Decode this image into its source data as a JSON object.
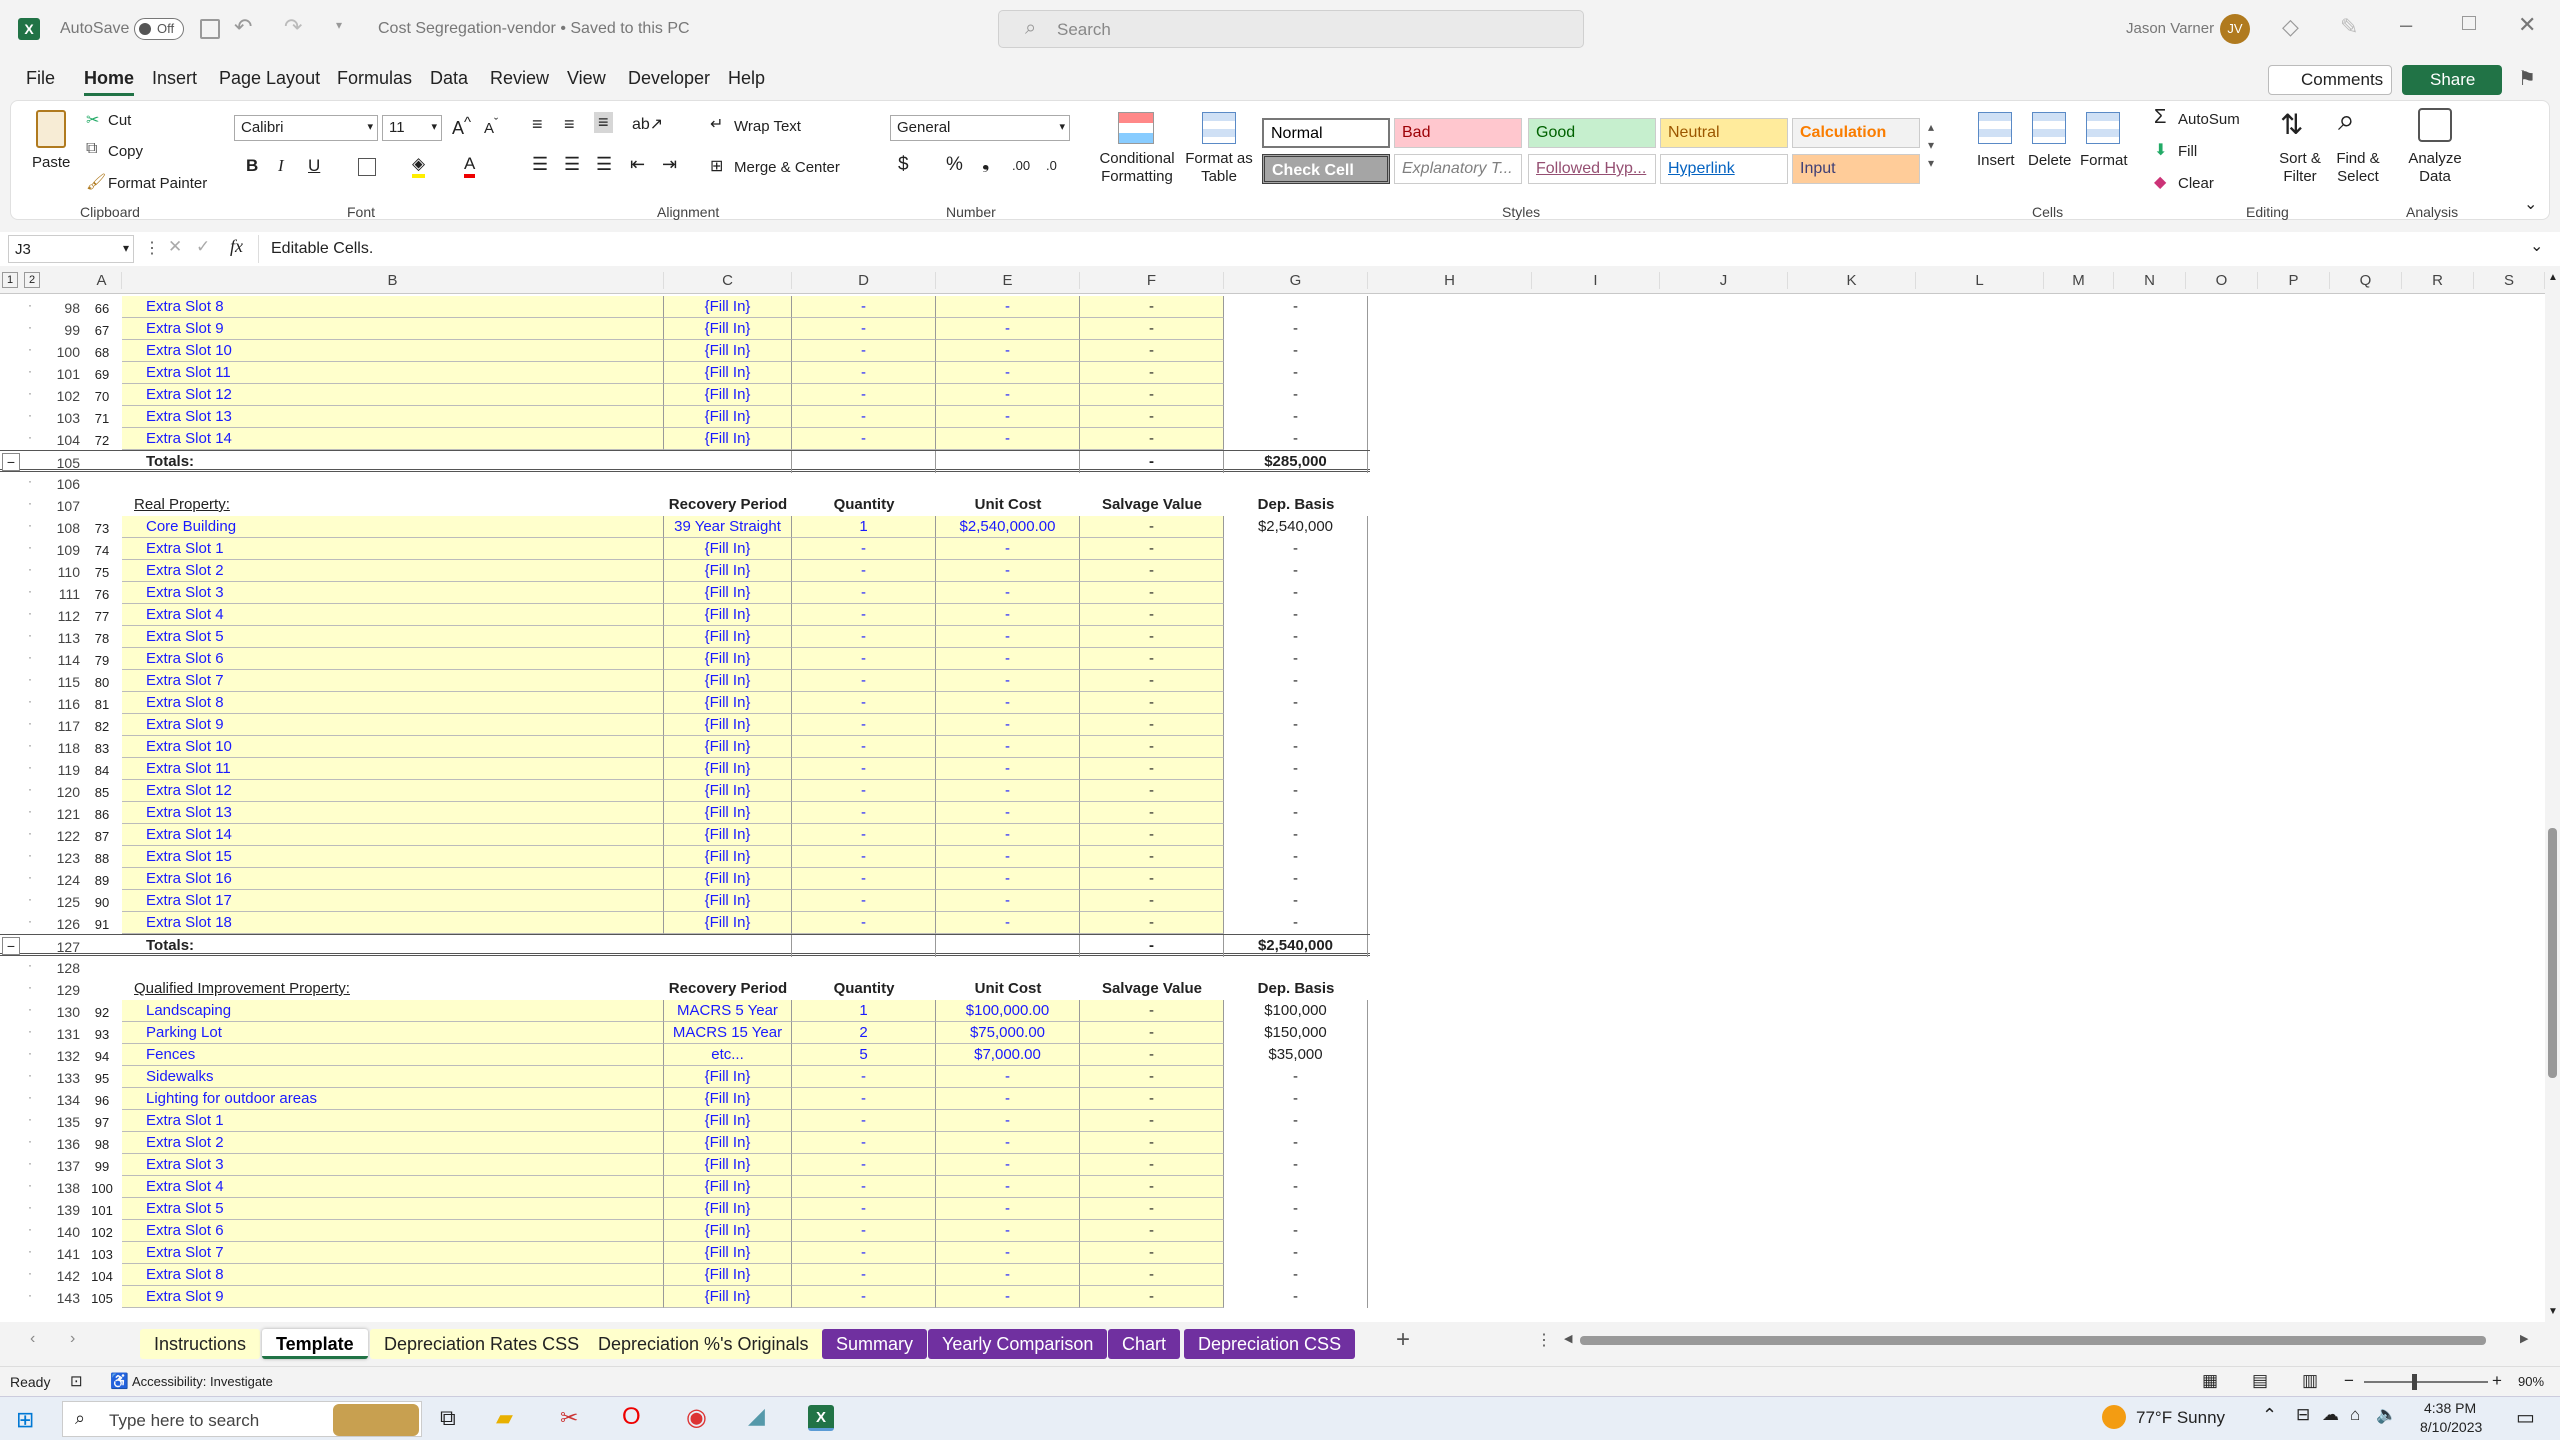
{
  "titlebar": {
    "autosave": "AutoSave",
    "autosave_state": "Off",
    "doc_title": "Cost Segregation-vendor • Saved to this PC",
    "search_placeholder": "Search",
    "user_name": "Jason Varner",
    "user_initials": "JV"
  },
  "menu": [
    "File",
    "Home",
    "Insert",
    "Page Layout",
    "Formulas",
    "Data",
    "Review",
    "View",
    "Developer",
    "Help"
  ],
  "menu_right": {
    "comments": "Comments",
    "share": "Share"
  },
  "ribbon": {
    "clipboard": {
      "paste": "Paste",
      "cut": "Cut",
      "copy": "Copy",
      "format_painter": "Format Painter",
      "label": "Clipboard"
    },
    "font": {
      "name": "Calibri",
      "size": "11",
      "label": "Font"
    },
    "alignment": {
      "wrap": "Wrap Text",
      "merge": "Merge & Center",
      "label": "Alignment"
    },
    "number": {
      "format": "General",
      "label": "Number"
    },
    "styles": {
      "cond": "Conditional Formatting",
      "table": "Format as Table",
      "label": "Styles",
      "cells": [
        {
          "t": "Normal",
          "bg": "#ffffff",
          "fg": "#000000"
        },
        {
          "t": "Bad",
          "bg": "#ffc7ce",
          "fg": "#9c0006"
        },
        {
          "t": "Good",
          "bg": "#c6efce",
          "fg": "#006100"
        },
        {
          "t": "Neutral",
          "bg": "#ffeb9c",
          "fg": "#9c5700"
        },
        {
          "t": "Calculation",
          "bg": "#f2f2f2",
          "fg": "#fa7d00"
        },
        {
          "t": "Check Cell",
          "bg": "#a5a5a5",
          "fg": "#ffffff"
        },
        {
          "t": "Explanatory T...",
          "bg": "#ffffff",
          "fg": "#7f7f7f"
        },
        {
          "t": "Followed Hyp...",
          "bg": "#ffffff",
          "fg": "#954f72"
        },
        {
          "t": "Hyperlink",
          "bg": "#ffffff",
          "fg": "#0563c1"
        },
        {
          "t": "Input",
          "bg": "#ffcc99",
          "fg": "#3f3f76"
        }
      ]
    },
    "cells": {
      "insert": "Insert",
      "delete": "Delete",
      "format": "Format",
      "label": "Cells"
    },
    "editing": {
      "autosum": "AutoSum",
      "fill": "Fill",
      "clear": "Clear",
      "sort": "Sort & Filter",
      "find": "Find & Select",
      "label": "Editing"
    },
    "analysis": {
      "analyze": "Analyze Data",
      "label": "Analysis"
    }
  },
  "formula_bar": {
    "name_box": "J3",
    "formula": "Editable Cells."
  },
  "columns": [
    "A",
    "B",
    "C",
    "D",
    "E",
    "F",
    "G",
    "H",
    "I",
    "J",
    "K",
    "L",
    "M",
    "N",
    "O",
    "P",
    "Q",
    "R",
    "S"
  ],
  "sheet": {
    "headers": {
      "recovery": "Recovery Period",
      "quantity": "Quantity",
      "unit_cost": "Unit Cost",
      "salvage": "Salvage Value",
      "basis": "Dep. Basis"
    },
    "real_property_title": "Real Property:",
    "qip_title": "Qualified Improvement Property:",
    "totals_label": "Totals:",
    "rows": [
      {
        "rn": "98",
        "a": "66",
        "b": "Extra Slot 8",
        "c": "{Fill In}",
        "d": "-",
        "e": "-",
        "f": "-",
        "g": "-",
        "k": "d"
      },
      {
        "rn": "99",
        "a": "67",
        "b": "Extra Slot 9",
        "c": "{Fill In}",
        "d": "-",
        "e": "-",
        "f": "-",
        "g": "-",
        "k": "d"
      },
      {
        "rn": "100",
        "a": "68",
        "b": "Extra Slot 10",
        "c": "{Fill In}",
        "d": "-",
        "e": "-",
        "f": "-",
        "g": "-",
        "k": "d"
      },
      {
        "rn": "101",
        "a": "69",
        "b": "Extra Slot 11",
        "c": "{Fill In}",
        "d": "-",
        "e": "-",
        "f": "-",
        "g": "-",
        "k": "d"
      },
      {
        "rn": "102",
        "a": "70",
        "b": "Extra Slot 12",
        "c": "{Fill In}",
        "d": "-",
        "e": "-",
        "f": "-",
        "g": "-",
        "k": "d"
      },
      {
        "rn": "103",
        "a": "71",
        "b": "Extra Slot 13",
        "c": "{Fill In}",
        "d": "-",
        "e": "-",
        "f": "-",
        "g": "-",
        "k": "d"
      },
      {
        "rn": "104",
        "a": "72",
        "b": "Extra Slot 14",
        "c": "{Fill In}",
        "d": "-",
        "e": "-",
        "f": "-",
        "g": "-",
        "k": "d"
      },
      {
        "rn": "105",
        "b": "Totals:",
        "f": "-",
        "g": "$285,000",
        "k": "t"
      },
      {
        "rn": "106",
        "k": "e"
      },
      {
        "rn": "107",
        "b": "Real Property:",
        "k": "h"
      },
      {
        "rn": "108",
        "a": "73",
        "b": "Core Building",
        "c": "39 Year Straight",
        "d": "1",
        "e": "$2,540,000.00",
        "f": "-",
        "g": "$2,540,000",
        "k": "d"
      },
      {
        "rn": "109",
        "a": "74",
        "b": "Extra Slot 1",
        "c": "{Fill In}",
        "d": "-",
        "e": "-",
        "f": "-",
        "g": "-",
        "k": "d"
      },
      {
        "rn": "110",
        "a": "75",
        "b": "Extra Slot 2",
        "c": "{Fill In}",
        "d": "-",
        "e": "-",
        "f": "-",
        "g": "-",
        "k": "d"
      },
      {
        "rn": "111",
        "a": "76",
        "b": "Extra Slot 3",
        "c": "{Fill In}",
        "d": "-",
        "e": "-",
        "f": "-",
        "g": "-",
        "k": "d"
      },
      {
        "rn": "112",
        "a": "77",
        "b": "Extra Slot 4",
        "c": "{Fill In}",
        "d": "-",
        "e": "-",
        "f": "-",
        "g": "-",
        "k": "d"
      },
      {
        "rn": "113",
        "a": "78",
        "b": "Extra Slot 5",
        "c": "{Fill In}",
        "d": "-",
        "e": "-",
        "f": "-",
        "g": "-",
        "k": "d"
      },
      {
        "rn": "114",
        "a": "79",
        "b": "Extra Slot 6",
        "c": "{Fill In}",
        "d": "-",
        "e": "-",
        "f": "-",
        "g": "-",
        "k": "d"
      },
      {
        "rn": "115",
        "a": "80",
        "b": "Extra Slot 7",
        "c": "{Fill In}",
        "d": "-",
        "e": "-",
        "f": "-",
        "g": "-",
        "k": "d"
      },
      {
        "rn": "116",
        "a": "81",
        "b": "Extra Slot 8",
        "c": "{Fill In}",
        "d": "-",
        "e": "-",
        "f": "-",
        "g": "-",
        "k": "d"
      },
      {
        "rn": "117",
        "a": "82",
        "b": "Extra Slot 9",
        "c": "{Fill In}",
        "d": "-",
        "e": "-",
        "f": "-",
        "g": "-",
        "k": "d"
      },
      {
        "rn": "118",
        "a": "83",
        "b": "Extra Slot 10",
        "c": "{Fill In}",
        "d": "-",
        "e": "-",
        "f": "-",
        "g": "-",
        "k": "d"
      },
      {
        "rn": "119",
        "a": "84",
        "b": "Extra Slot 11",
        "c": "{Fill In}",
        "d": "-",
        "e": "-",
        "f": "-",
        "g": "-",
        "k": "d"
      },
      {
        "rn": "120",
        "a": "85",
        "b": "Extra Slot 12",
        "c": "{Fill In}",
        "d": "-",
        "e": "-",
        "f": "-",
        "g": "-",
        "k": "d"
      },
      {
        "rn": "121",
        "a": "86",
        "b": "Extra Slot 13",
        "c": "{Fill In}",
        "d": "-",
        "e": "-",
        "f": "-",
        "g": "-",
        "k": "d"
      },
      {
        "rn": "122",
        "a": "87",
        "b": "Extra Slot 14",
        "c": "{Fill In}",
        "d": "-",
        "e": "-",
        "f": "-",
        "g": "-",
        "k": "d"
      },
      {
        "rn": "123",
        "a": "88",
        "b": "Extra Slot 15",
        "c": "{Fill In}",
        "d": "-",
        "e": "-",
        "f": "-",
        "g": "-",
        "k": "d"
      },
      {
        "rn": "124",
        "a": "89",
        "b": "Extra Slot 16",
        "c": "{Fill In}",
        "d": "-",
        "e": "-",
        "f": "-",
        "g": "-",
        "k": "d"
      },
      {
        "rn": "125",
        "a": "90",
        "b": "Extra Slot 17",
        "c": "{Fill In}",
        "d": "-",
        "e": "-",
        "f": "-",
        "g": "-",
        "k": "d"
      },
      {
        "rn": "126",
        "a": "91",
        "b": "Extra Slot 18",
        "c": "{Fill In}",
        "d": "-",
        "e": "-",
        "f": "-",
        "g": "-",
        "k": "d"
      },
      {
        "rn": "127",
        "b": "Totals:",
        "f": "-",
        "g": "$2,540,000",
        "k": "t"
      },
      {
        "rn": "128",
        "k": "e"
      },
      {
        "rn": "129",
        "b": "Qualified Improvement Property:",
        "k": "h"
      },
      {
        "rn": "130",
        "a": "92",
        "b": "Landscaping",
        "c": "MACRS 5 Year",
        "d": "1",
        "e": "$100,000.00",
        "f": "-",
        "g": "$100,000",
        "k": "d"
      },
      {
        "rn": "131",
        "a": "93",
        "b": "Parking Lot",
        "c": "MACRS 15 Year",
        "d": "2",
        "e": "$75,000.00",
        "f": "-",
        "g": "$150,000",
        "k": "d"
      },
      {
        "rn": "132",
        "a": "94",
        "b": "Fences",
        "c": "etc...",
        "d": "5",
        "e": "$7,000.00",
        "f": "-",
        "g": "$35,000",
        "k": "d"
      },
      {
        "rn": "133",
        "a": "95",
        "b": "Sidewalks",
        "c": "{Fill In}",
        "d": "-",
        "e": "-",
        "f": "-",
        "g": "-",
        "k": "d"
      },
      {
        "rn": "134",
        "a": "96",
        "b": "Lighting for outdoor areas",
        "c": "{Fill In}",
        "d": "-",
        "e": "-",
        "f": "-",
        "g": "-",
        "k": "d"
      },
      {
        "rn": "135",
        "a": "97",
        "b": "Extra Slot 1",
        "c": "{Fill In}",
        "d": "-",
        "e": "-",
        "f": "-",
        "g": "-",
        "k": "d"
      },
      {
        "rn": "136",
        "a": "98",
        "b": "Extra Slot 2",
        "c": "{Fill In}",
        "d": "-",
        "e": "-",
        "f": "-",
        "g": "-",
        "k": "d"
      },
      {
        "rn": "137",
        "a": "99",
        "b": "Extra Slot 3",
        "c": "{Fill In}",
        "d": "-",
        "e": "-",
        "f": "-",
        "g": "-",
        "k": "d"
      },
      {
        "rn": "138",
        "a": "100",
        "b": "Extra Slot 4",
        "c": "{Fill In}",
        "d": "-",
        "e": "-",
        "f": "-",
        "g": "-",
        "k": "d"
      },
      {
        "rn": "139",
        "a": "101",
        "b": "Extra Slot 5",
        "c": "{Fill In}",
        "d": "-",
        "e": "-",
        "f": "-",
        "g": "-",
        "k": "d"
      },
      {
        "rn": "140",
        "a": "102",
        "b": "Extra Slot 6",
        "c": "{Fill In}",
        "d": "-",
        "e": "-",
        "f": "-",
        "g": "-",
        "k": "d"
      },
      {
        "rn": "141",
        "a": "103",
        "b": "Extra Slot 7",
        "c": "{Fill In}",
        "d": "-",
        "e": "-",
        "f": "-",
        "g": "-",
        "k": "d"
      },
      {
        "rn": "142",
        "a": "104",
        "b": "Extra Slot 8",
        "c": "{Fill In}",
        "d": "-",
        "e": "-",
        "f": "-",
        "g": "-",
        "k": "d"
      },
      {
        "rn": "143",
        "a": "105",
        "b": "Extra Slot 9",
        "c": "{Fill In}",
        "d": "-",
        "e": "-",
        "f": "-",
        "g": "-",
        "k": "d"
      }
    ]
  },
  "tabs": [
    {
      "label": "Instructions",
      "bg": "#ffffcc",
      "fg": "#222222"
    },
    {
      "label": "Template",
      "bg": "#ffffff",
      "fg": "#000000",
      "active": true
    },
    {
      "label": "Depreciation Rates CSS",
      "bg": "#ffffcc",
      "fg": "#222222"
    },
    {
      "label": "Depreciation %'s Originals",
      "bg": "#ffffcc",
      "fg": "#222222"
    },
    {
      "label": "Summary",
      "bg": "#7030a0",
      "fg": "#ffffff"
    },
    {
      "label": "Yearly Comparison",
      "bg": "#7030a0",
      "fg": "#ffffff"
    },
    {
      "label": "Chart",
      "bg": "#7030a0",
      "fg": "#ffffff"
    },
    {
      "label": "Depreciation CSS",
      "bg": "#7030a0",
      "fg": "#ffffff"
    }
  ],
  "status": {
    "ready": "Ready",
    "accessibility": "Accessibility: Investigate",
    "zoom": "90%"
  },
  "taskbar": {
    "search_placeholder": "Type here to search",
    "weather": "77°F  Sunny",
    "time": "4:38 PM",
    "date": "8/10/2023"
  },
  "colors": {
    "excel_green": "#217346",
    "cell_yellow": "#ffffcc",
    "cell_blue_text": "#1a1aff",
    "tab_purple": "#7030a0"
  }
}
